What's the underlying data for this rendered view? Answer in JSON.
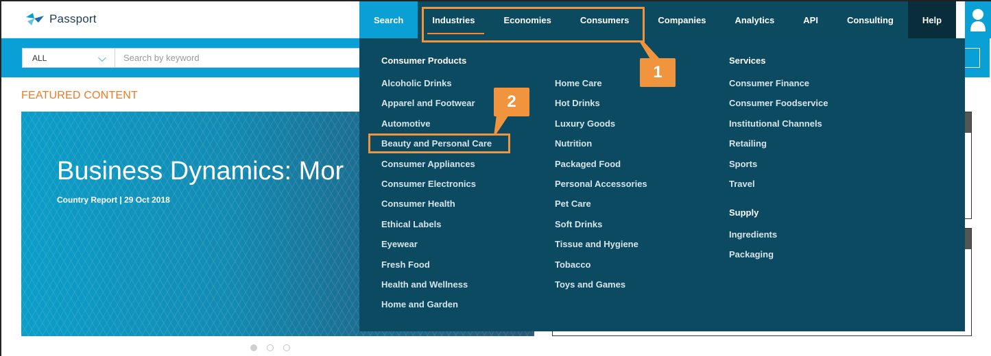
{
  "app": {
    "logo_text": "Passport"
  },
  "nav": {
    "items": [
      {
        "label": "Search"
      },
      {
        "label": "Industries"
      },
      {
        "label": "Economies"
      },
      {
        "label": "Consumers"
      },
      {
        "label": "Companies"
      },
      {
        "label": "Analytics"
      },
      {
        "label": "API"
      },
      {
        "label": "Consulting"
      },
      {
        "label": "Help"
      }
    ]
  },
  "search": {
    "scope": "ALL",
    "placeholder": "Search by keyword"
  },
  "featured": {
    "heading": "FEATURED CONTENT",
    "hero_title": "Business Dynamics: Mor",
    "hero_subtitle": "Country Report | 29 Oct 2018"
  },
  "menu": {
    "consumer_products": {
      "heading": "Consumer Products",
      "col1": [
        "Alcoholic Drinks",
        "Apparel and Footwear",
        "Automotive",
        "Beauty and Personal Care",
        "Consumer Appliances",
        "Consumer Electronics",
        "Consumer Health",
        "Ethical Labels",
        "Eyewear",
        "Fresh Food",
        "Health and Wellness",
        "Home and Garden"
      ],
      "col2": [
        "Home Care",
        "Hot Drinks",
        "Luxury Goods",
        "Nutrition",
        "Packaged Food",
        "Personal Accessories",
        "Pet Care",
        "Soft Drinks",
        "Tissue and Hygiene",
        "Tobacco",
        "Toys and Games"
      ]
    },
    "services": {
      "heading": "Services",
      "items": [
        "Consumer Finance",
        "Consumer Foodservice",
        "Institutional Channels",
        "Retailing",
        "Sports",
        "Travel"
      ]
    },
    "supply": {
      "heading": "Supply",
      "items": [
        "Ingredients",
        "Packaging"
      ]
    }
  },
  "annotations": {
    "badge1": "1",
    "badge2": "2",
    "color": "#f0943e"
  },
  "colors": {
    "accent": "#0aa0d6",
    "nav_dark": "#0c4a60",
    "menu_bg": "#0b4a61",
    "featured": "#f07a22"
  }
}
